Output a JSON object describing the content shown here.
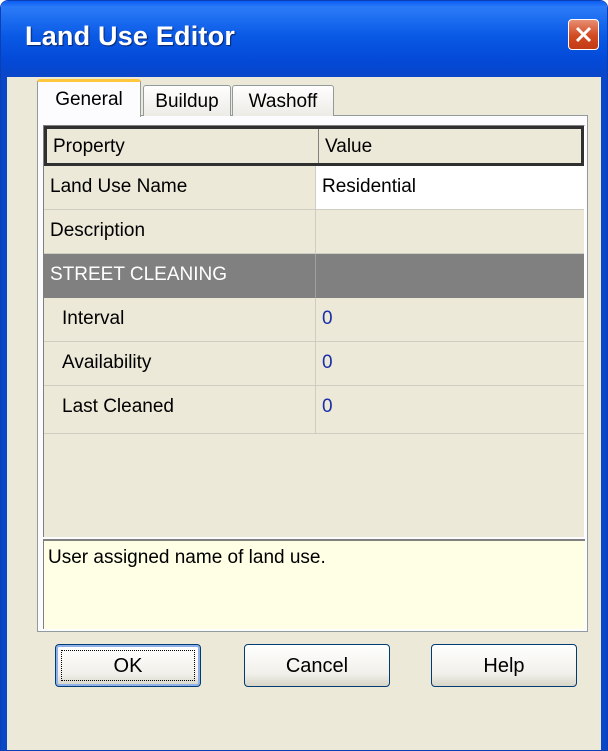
{
  "window": {
    "title": "Land Use Editor"
  },
  "tabs": [
    {
      "label": "General",
      "active": true
    },
    {
      "label": "Buildup",
      "active": false
    },
    {
      "label": "Washoff",
      "active": false
    }
  ],
  "grid": {
    "headers": {
      "property": "Property",
      "value": "Value"
    },
    "rows": [
      {
        "property": "Land Use Name",
        "value": "Residential"
      },
      {
        "property": "Description",
        "value": ""
      },
      {
        "section": "STREET CLEANING"
      },
      {
        "property": "Interval",
        "value": "0"
      },
      {
        "property": "Availability",
        "value": "0"
      },
      {
        "property": "Last Cleaned",
        "value": "0"
      }
    ]
  },
  "description_text": "User assigned name of land use.",
  "buttons": {
    "ok": "OK",
    "cancel": "Cancel",
    "help": "Help"
  },
  "icons": {
    "close": "close-icon"
  },
  "colors": {
    "titlebar": "#0a5ae6",
    "section_bg": "#808080",
    "value_number": "#1a2ea8",
    "close_button": "#d14a22"
  }
}
